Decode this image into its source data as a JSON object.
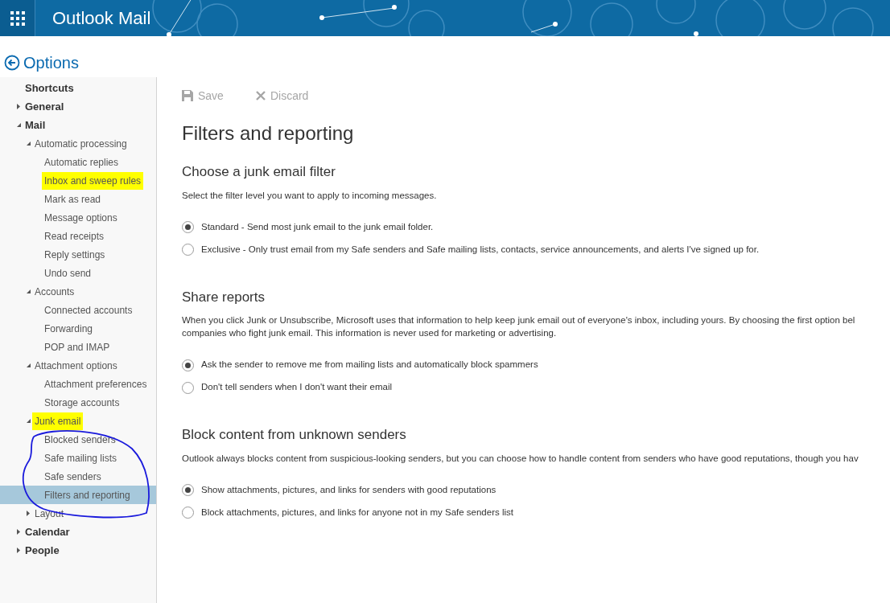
{
  "header": {
    "title": "Outlook Mail"
  },
  "options_title": "Options",
  "sidebar": {
    "items": [
      {
        "label": "Shortcuts",
        "selected": false,
        "highlighted": false
      },
      {
        "label": "General",
        "expanded": false,
        "selected": false,
        "highlighted": false
      },
      {
        "label": "Mail",
        "expanded": true,
        "selected": false,
        "highlighted": false,
        "children": [
          {
            "label": "Automatic processing",
            "expanded": true,
            "selected": false,
            "highlighted": false,
            "children": [
              {
                "label": "Automatic replies",
                "selected": false,
                "highlighted": false
              },
              {
                "label": "Inbox and sweep rules",
                "selected": false,
                "highlighted": true
              },
              {
                "label": "Mark as read",
                "selected": false,
                "highlighted": false
              },
              {
                "label": "Message options",
                "selected": false,
                "highlighted": false
              },
              {
                "label": "Read receipts",
                "selected": false,
                "highlighted": false
              },
              {
                "label": "Reply settings",
                "selected": false,
                "highlighted": false
              },
              {
                "label": "Undo send",
                "selected": false,
                "highlighted": false
              }
            ]
          },
          {
            "label": "Accounts",
            "expanded": true,
            "selected": false,
            "highlighted": false,
            "children": [
              {
                "label": "Connected accounts",
                "selected": false,
                "highlighted": false
              },
              {
                "label": "Forwarding",
                "selected": false,
                "highlighted": false
              },
              {
                "label": "POP and IMAP",
                "selected": false,
                "highlighted": false
              }
            ]
          },
          {
            "label": "Attachment options",
            "expanded": true,
            "selected": false,
            "highlighted": false,
            "children": [
              {
                "label": "Attachment preferences",
                "selected": false,
                "highlighted": false
              },
              {
                "label": "Storage accounts",
                "selected": false,
                "highlighted": false
              }
            ]
          },
          {
            "label": "Junk email",
            "expanded": true,
            "selected": false,
            "highlighted": true,
            "children": [
              {
                "label": "Blocked senders",
                "selected": false,
                "highlighted": false
              },
              {
                "label": "Safe mailing lists",
                "selected": false,
                "highlighted": false
              },
              {
                "label": "Safe senders",
                "selected": false,
                "highlighted": false
              },
              {
                "label": "Filters and reporting",
                "selected": true,
                "highlighted": false
              }
            ]
          },
          {
            "label": "Layout",
            "expanded": false,
            "selected": false,
            "highlighted": false
          }
        ]
      },
      {
        "label": "Calendar",
        "expanded": false,
        "selected": false,
        "highlighted": false
      },
      {
        "label": "People",
        "expanded": false,
        "selected": false,
        "highlighted": false
      }
    ]
  },
  "toolbar": [
    {
      "kind": "save",
      "label": "Save",
      "disabled": true
    },
    {
      "kind": "discard",
      "label": "Discard",
      "disabled": true
    }
  ],
  "page_title": "Filters and reporting",
  "sections": [
    {
      "heading": "Choose a junk email filter",
      "description": [
        "Select the filter level you want to apply to incoming messages."
      ],
      "options": [
        {
          "label": "Standard - Send most junk email to the junk email folder.",
          "selected": true
        },
        {
          "label": "Exclusive - Only trust email from my Safe senders and Safe mailing lists, contacts, service announcements, and alerts I've signed up for.",
          "selected": false
        }
      ]
    },
    {
      "heading": "Share reports",
      "description": [
        "When you click Junk or Unsubscribe, Microsoft uses that information to help keep junk email out of everyone's inbox, including yours. By choosing the first option bel",
        "companies who fight junk email. This information is never used for marketing or advertising."
      ],
      "options": [
        {
          "label": "Ask the sender to remove me from mailing lists and automatically block spammers",
          "selected": true
        },
        {
          "label": "Don't tell senders when I don't want their email",
          "selected": false
        }
      ]
    },
    {
      "heading": "Block content from unknown senders",
      "description": [
        "Outlook always blocks content from suspicious-looking senders, but you can choose how to handle content from senders who have good reputations, though you hav"
      ],
      "options": [
        {
          "label": "Show attachments, pictures, and links for senders with good reputations",
          "selected": true
        },
        {
          "label": "Block attachments, pictures, and links for anyone not in my Safe senders list",
          "selected": false
        }
      ]
    }
  ]
}
